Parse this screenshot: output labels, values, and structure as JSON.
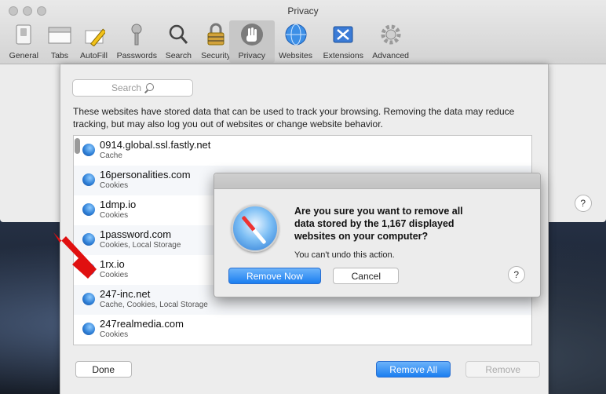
{
  "window": {
    "title": "Privacy"
  },
  "toolbar": {
    "items": [
      {
        "label": "General",
        "icon": "switch-icon"
      },
      {
        "label": "Tabs",
        "icon": "tabs-icon"
      },
      {
        "label": "AutoFill",
        "icon": "pencil-icon"
      },
      {
        "label": "Passwords",
        "icon": "key-icon"
      },
      {
        "label": "Search",
        "icon": "search-icon"
      },
      {
        "label": "Security",
        "icon": "lock-icon"
      },
      {
        "label": "Privacy",
        "icon": "hand-icon",
        "active": true
      },
      {
        "label": "Websites",
        "icon": "globe-icon"
      },
      {
        "label": "Extensions",
        "icon": "puzzle-icon"
      },
      {
        "label": "Advanced",
        "icon": "gear-icon"
      }
    ]
  },
  "privacy": {
    "search_placeholder": "Search",
    "explanation": "These websites have stored data that can be used to track your browsing. Removing the data may reduce tracking, but may also log you out of websites or change website behavior.",
    "sites": [
      {
        "name": "0914.global.ssl.fastly.net",
        "kind": "Cache"
      },
      {
        "name": "16personalities.com",
        "kind": "Cookies"
      },
      {
        "name": "1dmp.io",
        "kind": "Cookies"
      },
      {
        "name": "1password.com",
        "kind": "Cookies, Local Storage"
      },
      {
        "name": "1rx.io",
        "kind": "Cookies"
      },
      {
        "name": "247-inc.net",
        "kind": "Cache, Cookies, Local Storage"
      },
      {
        "name": "247realmedia.com",
        "kind": "Cookies"
      }
    ],
    "remove_label": "Remove",
    "remove_all_label": "Remove All",
    "done_label": "Done",
    "help_label": "?"
  },
  "alert": {
    "message": "Are you sure you want to remove all data stored by the 1,167 displayed websites on your computer?",
    "sub": "You can't undo this action.",
    "cancel_label": "Cancel",
    "remove_now_label": "Remove Now",
    "help_label": "?"
  },
  "colors": {
    "accent": "#1b7ef0",
    "arrow": "#e01010"
  }
}
